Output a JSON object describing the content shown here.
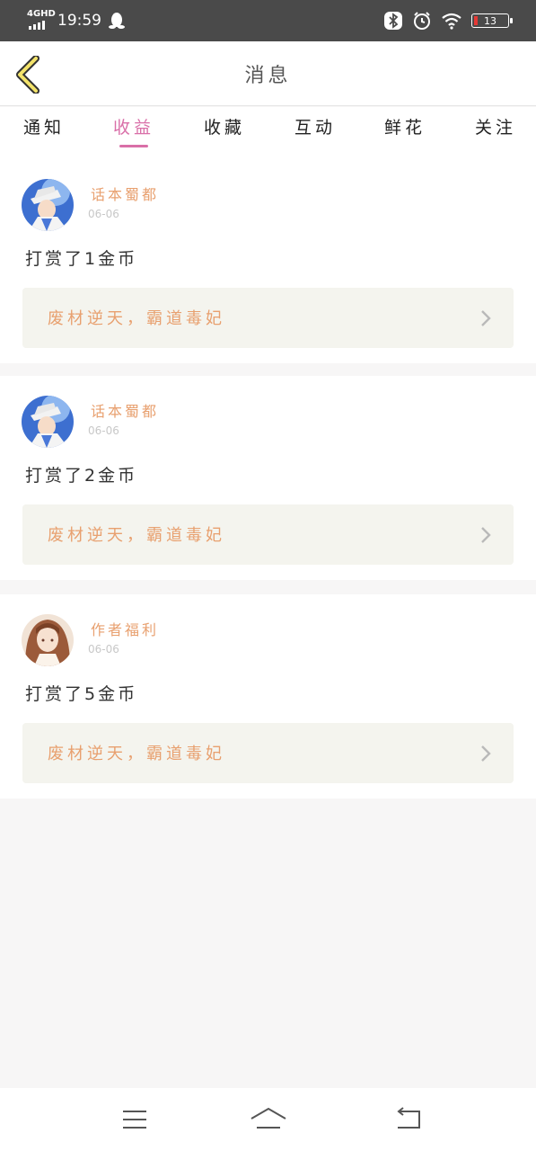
{
  "status_bar": {
    "network": "4GHD",
    "time": "19:59",
    "battery": "13"
  },
  "header": {
    "title": "消息"
  },
  "tabs": [
    {
      "label": "通知",
      "active": false
    },
    {
      "label": "收益",
      "active": true
    },
    {
      "label": "收藏",
      "active": false
    },
    {
      "label": "互动",
      "active": false
    },
    {
      "label": "鲜花",
      "active": false
    },
    {
      "label": "关注",
      "active": false
    }
  ],
  "messages": [
    {
      "sender": "话本蜀都",
      "date": "06-06",
      "text": "打赏了1金币",
      "book": "废材逆天，霸道毒妃",
      "avatar": "avatar-kid-icon"
    },
    {
      "sender": "话本蜀都",
      "date": "06-06",
      "text": "打赏了2金币",
      "book": "废材逆天，霸道毒妃",
      "avatar": "avatar-kid-icon"
    },
    {
      "sender": "作者福利",
      "date": "06-06",
      "text": "打赏了5金币",
      "book": "废材逆天，霸道毒妃",
      "avatar": "avatar-girl-icon"
    }
  ],
  "colors": {
    "accent": "#d96fa8",
    "sender": "#e8a06f",
    "book_bg": "#f4f4ee"
  }
}
